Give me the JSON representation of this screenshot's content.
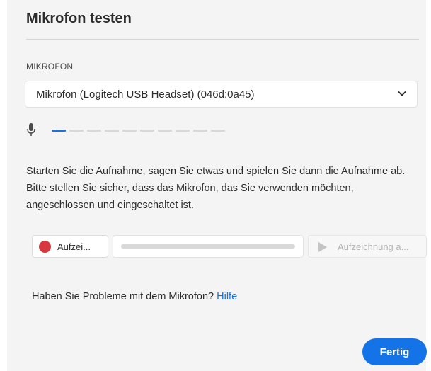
{
  "dialog": {
    "title": "Mikrofon testen"
  },
  "microphone": {
    "section_label": "MIKROFON",
    "selected_device": "Mikrofon (Logitech USB Headset) (046d:0a45)",
    "level": {
      "segments_total": 10,
      "segments_active": 1,
      "active_color": "#1473e6",
      "inactive_color": "#d8d8d8"
    }
  },
  "instructions": "Starten Sie die Aufnahme, sagen Sie etwas und spielen Sie dann die Aufnahme ab. Bitte stellen Sie sicher, dass das Mikrofon, das Sie verwenden möchten, angeschlossen und eingeschaltet ist.",
  "recording": {
    "record_label": "Aufzei...",
    "record_color": "#d7373f",
    "progress": 0,
    "play_label": "Aufzeichnung a...",
    "play_enabled": false
  },
  "help": {
    "question": "Haben Sie Probleme mit dem Mikrofon?",
    "link_label": "Hilfe"
  },
  "footer": {
    "done_label": "Fertig"
  },
  "colors": {
    "accent": "#1473e6",
    "panel_background": "#f4f4f4"
  },
  "icons": {
    "select_toggle": "chevron-down-icon",
    "level": "microphone-icon",
    "record": "record-dot-icon",
    "play": "play-icon"
  }
}
